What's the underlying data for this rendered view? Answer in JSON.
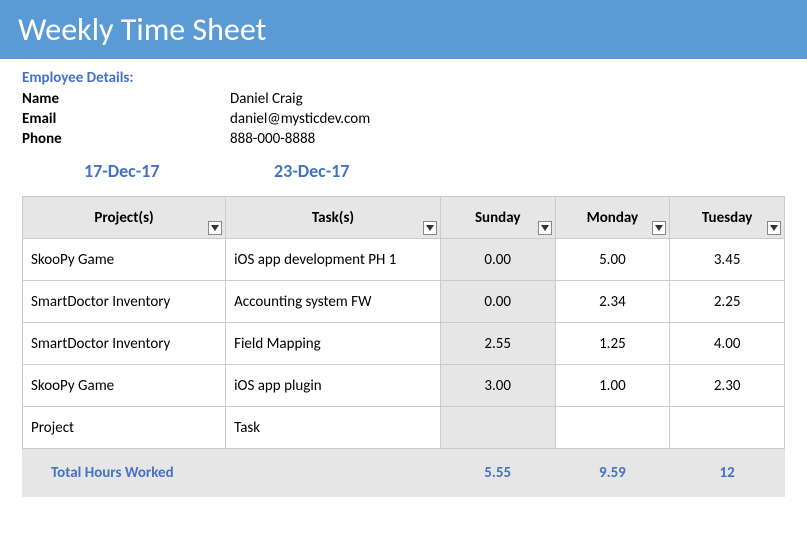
{
  "title": "Weekly Time Sheet",
  "employee_header": "Employee Details:",
  "labels": {
    "name": "Name",
    "email": "Email",
    "phone": "Phone"
  },
  "employee": {
    "name": "Daniel Craig",
    "email": "daniel@mysticdev.com",
    "phone": "888-000-8888"
  },
  "dates": {
    "start": "17-Dec-17",
    "end": "23-Dec-17"
  },
  "columns": [
    "Project(s)",
    "Task(s)",
    "Sunday",
    "Monday",
    "Tuesday"
  ],
  "rows": [
    {
      "project": "SkooPy Game",
      "task": "iOS app development PH 1",
      "sun": "0.00",
      "mon": "5.00",
      "tue": "3.45"
    },
    {
      "project": "SmartDoctor Inventory",
      "task": "Accounting system FW",
      "sun": "0.00",
      "mon": "2.34",
      "tue": "2.25"
    },
    {
      "project": "SmartDoctor Inventory",
      "task": "Field Mapping",
      "sun": "2.55",
      "mon": "1.25",
      "tue": "4.00"
    },
    {
      "project": "SkooPy Game",
      "task": "iOS app plugin",
      "sun": "3.00",
      "mon": "1.00",
      "tue": "2.30"
    },
    {
      "project": "Project",
      "task": "Task",
      "sun": "",
      "mon": "",
      "tue": ""
    }
  ],
  "totals": {
    "label": "Total Hours Worked",
    "sun": "5.55",
    "mon": "9.59",
    "tue": "12"
  }
}
